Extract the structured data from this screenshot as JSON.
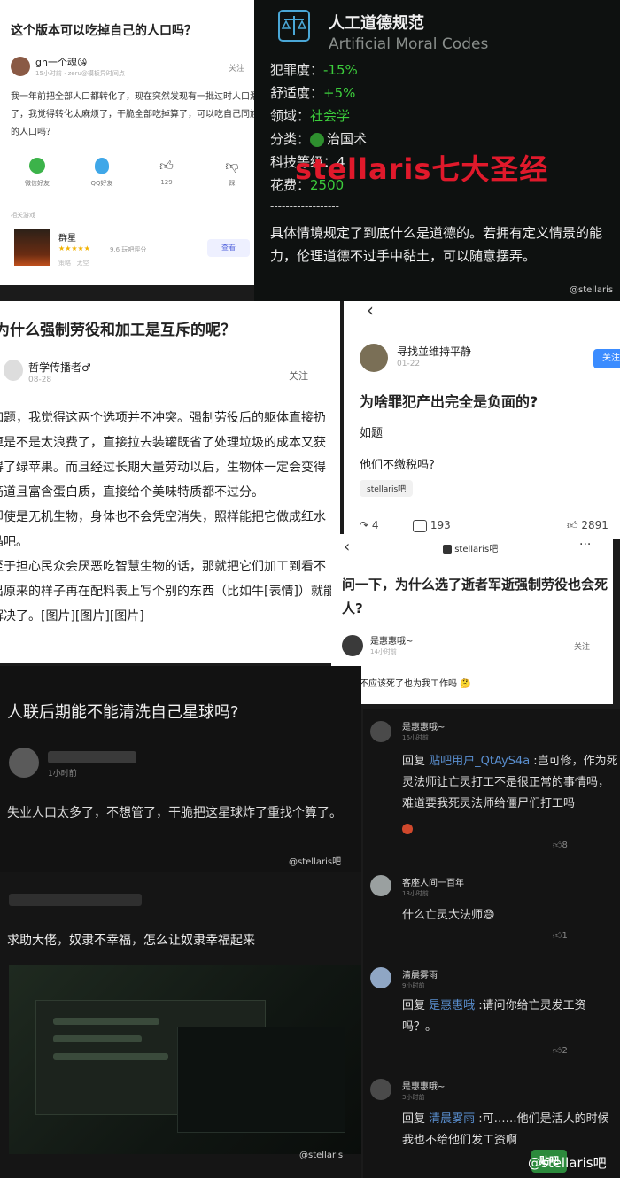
{
  "p1": {
    "title": "这个版本可以吃掉自己的人口吗？",
    "author": "gn一个魂😘",
    "meta": "15小时前 · zeru@模板异时间点",
    "follow": "关注",
    "body": "我一年前把全部人口都转化了，现在突然发现有一批过时人口漏了，我觉得转化太麻烦了，干脆全部吃掉算了，可以吃自己同族的人口吗？",
    "actions": [
      "微信好友",
      "QQ好友",
      "129",
      "踩"
    ],
    "related_label": "相关游戏",
    "game_name": "群星",
    "game_rating": "9.6 玩吧评分",
    "game_sub": "策略 · 太空",
    "game_btn": "查看"
  },
  "p2": {
    "name": "人工道德规范",
    "name_en": "Artificial Moral Codes",
    "lines": [
      {
        "label": "犯罪度：",
        "value": "-15%"
      },
      {
        "label": "舒适度：",
        "value": "+5%"
      },
      {
        "label": "领域：",
        "value": "社会学"
      },
      {
        "label": "分类：",
        "value": "治国术"
      },
      {
        "label": "科技等级：",
        "value": "4"
      },
      {
        "label": "花费：",
        "value": "2500"
      }
    ],
    "overlay": "stellaris七大圣经",
    "dashes": "------------------",
    "desc": "具体情境规定了到底什么是道德的。若拥有定义情景的能力，伦理道德不过手中黏土，可以随意摆弄。",
    "watermark": "@stellaris"
  },
  "p3": {
    "title": "为什么强制劳役和加工是互斥的呢？",
    "author": "哲学传播者♂",
    "date": "08-28",
    "follow": "关注",
    "body": [
      "如题，我觉得这两个选项并不冲突。强制劳役后的躯体直接扔掉是不是太浪费了，直接拉去装罐既省了处理垃圾的成本又获得了绿苹果。而且经过长期大量劳动以后，生物体一定会变得筋道且富含蛋白质，直接给个美味特质都不过分。",
      "即使是无机生物，身体也不会凭空消失，照样能把它做成红水晶吧。",
      "至于担心民众会厌恶吃智慧生物的话，那就把它们加工到看不出原来的样子再在配料表上写个别的东西（比如牛[表情]）就能解决了。[图片][图片][图片]"
    ]
  },
  "p4": {
    "author": "寻找並维持平静",
    "date": "01-22",
    "follow": "关注",
    "title": "为啥罪犯产出完全是负面的?",
    "line1": "如题",
    "line2": "他们不缴税吗?",
    "tag": "stellaris吧",
    "share": "4",
    "comments": "193",
    "likes": "2891"
  },
  "p5": {
    "header": "stellaris吧",
    "more": "···",
    "title": "问一下，为什么选了逝者军逝强制劳役也会死人?",
    "author": "是惠惠哦~",
    "meta": "14小时前",
    "follow": "关注",
    "body": "他们不应该死了也为我工作吗 🤔"
  },
  "p6": {
    "title": "人联后期能不能清洗自己星球吗?",
    "meta": "1小时前",
    "body": "失业人口太多了，不想管了，干脆把这星球炸了重找个算了。",
    "watermark": "@stellaris吧"
  },
  "p7": {
    "title": "求助大佬，奴隶不幸福，怎么让奴隶幸福起来",
    "watermark": "@stellaris"
  },
  "p8": {
    "comments": [
      {
        "author": "是惠惠哦~",
        "time": "16小时前",
        "reply_prefix": "回复 ",
        "reply_to": "贴吧用户_QtAyS4a",
        "text": " :岂可修，作为死灵法师让亡灵打工不是很正常的事情吗，难道要我死灵法师给僵尸们打工吗",
        "likes": "8"
      },
      {
        "author": "客座人间一百年",
        "time": "13小时前",
        "reply_prefix": "",
        "reply_to": "",
        "text": "什么亡灵大法师😄",
        "likes": "1"
      },
      {
        "author": "清晨雾雨",
        "time": "9小时前",
        "reply_prefix": "回复 ",
        "reply_to": "是惠惠哦",
        "text": " :请问你给亡灵发工资吗？。",
        "likes": "2"
      },
      {
        "author": "是惠惠哦~",
        "time": "3小时前",
        "reply_prefix": "回复 ",
        "reply_to": "清晨雾雨",
        "text": " :可……他们是活人的时候我也不给他们发工资啊",
        "likes": ""
      }
    ],
    "watermark": "@stellaris吧",
    "logo": "贴吧"
  },
  "colors": {
    "accent": "#3b8cff",
    "positive": "#3ccd3c",
    "overlay_red": "#e0192b"
  }
}
